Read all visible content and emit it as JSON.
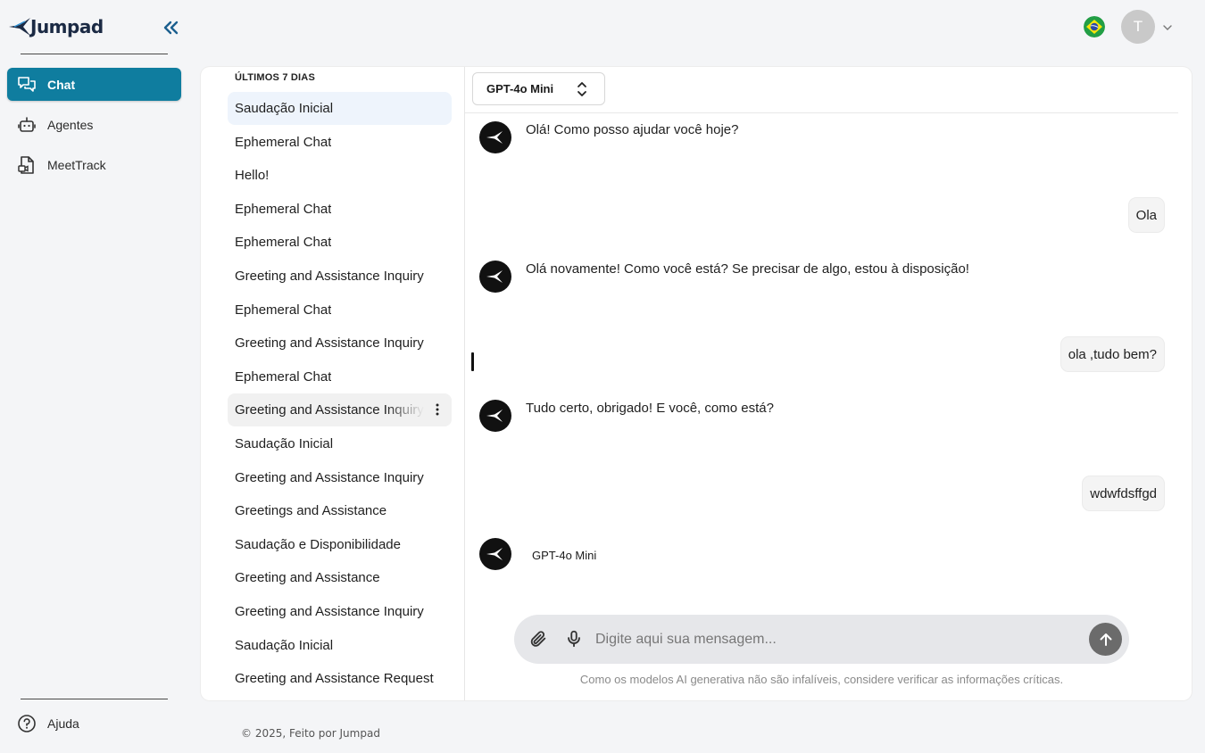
{
  "brand": {
    "name": "Jumpad",
    "accent": "#0f7d9f"
  },
  "sidebar": {
    "items": [
      {
        "label": "Chat",
        "icon": "chat-bubbles-icon",
        "active": true
      },
      {
        "label": "Agentes",
        "icon": "robot-icon",
        "active": false
      },
      {
        "label": "MeetTrack",
        "icon": "meeting-file-icon",
        "active": false
      }
    ],
    "help_label": "Ajuda"
  },
  "header": {
    "language_icon": "brazil-flag-icon",
    "avatar_initial": "T"
  },
  "history": {
    "heading": "ÚLTIMOS 7 DIAS",
    "items": [
      "Saudação Inicial",
      "Ephemeral Chat",
      "Hello!",
      "Ephemeral Chat",
      "Ephemeral Chat",
      "Greeting and Assistance Inquiry",
      "Ephemeral Chat",
      "Greeting and Assistance Inquiry",
      "Ephemeral Chat",
      "Greeting and Assistance Inquiry",
      "Saudação Inicial",
      "Greeting and Assistance Inquiry",
      "Greetings and Assistance",
      "Saudação e Disponibilidade",
      "Greeting and Assistance",
      "Greeting and Assistance Inquiry",
      "Saudação Inicial",
      "Greeting and Assistance Request"
    ]
  },
  "chat": {
    "model": "GPT-4o Mini",
    "messages": [
      {
        "role": "assistant",
        "text": "Olá! Como posso ajudar você hoje?"
      },
      {
        "role": "user",
        "text": "Ola"
      },
      {
        "role": "assistant",
        "text": "Olá novamente! Como você está? Se precisar de algo, estou à disposição!"
      },
      {
        "role": "user",
        "text": "ola ,tudo bem?"
      },
      {
        "role": "assistant",
        "text": "Tudo certo, obrigado! E você, como está?"
      },
      {
        "role": "user",
        "text": "wdwfdsffgd"
      }
    ],
    "pending_model_label": "GPT-4o Mini",
    "input_placeholder": "Digite aqui sua mensagem...",
    "disclaimer": "Como os modelos AI generativa não são infalíveis, considere verificar as informações críticas."
  },
  "footer": {
    "text": "© 2025, Feito por Jumpad"
  }
}
